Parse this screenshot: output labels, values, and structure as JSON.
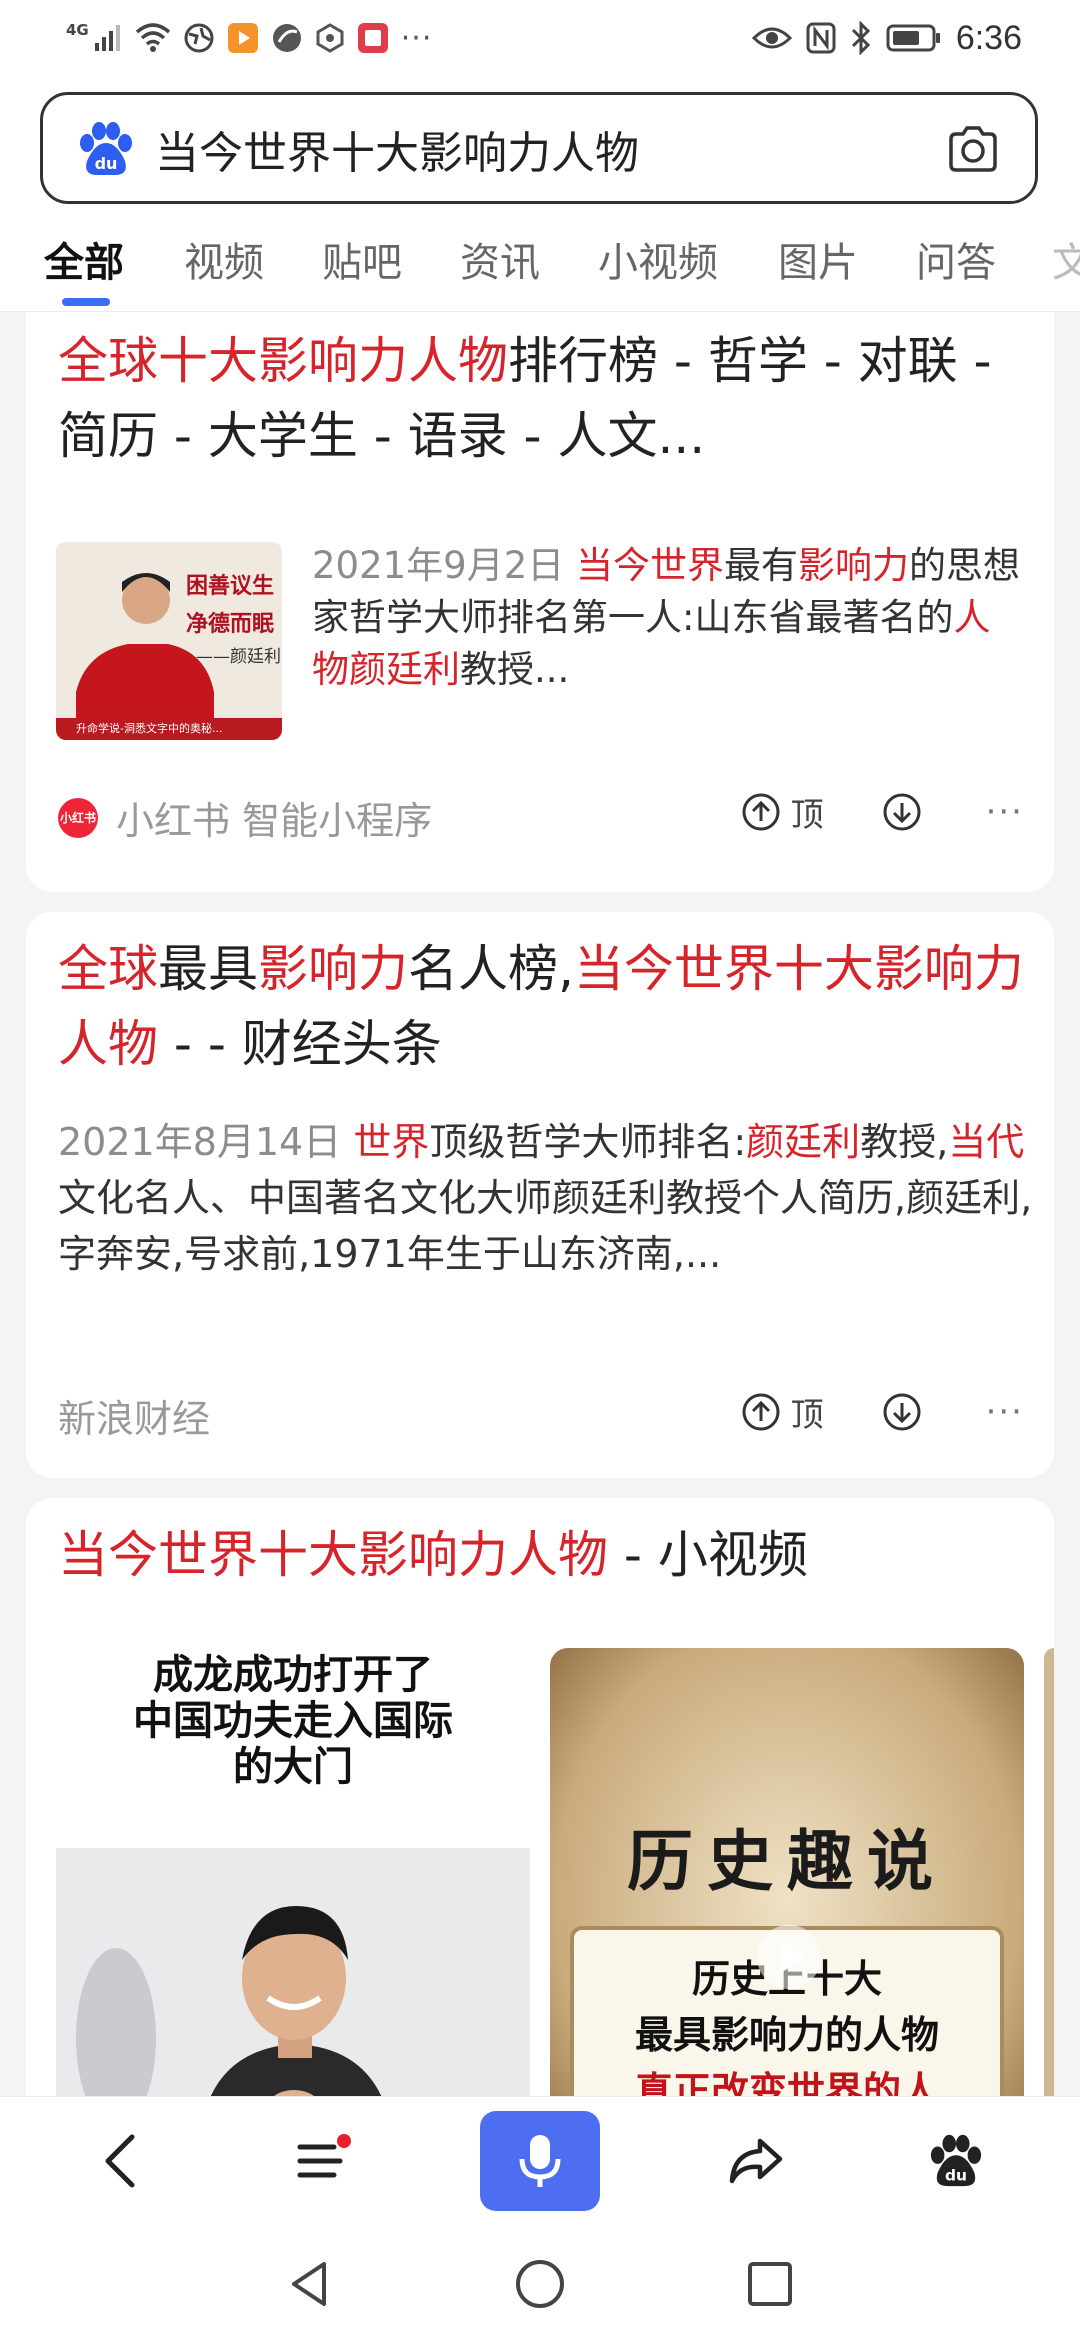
{
  "status_bar": {
    "network": "4G",
    "signal_icon": "signal-bars-icon",
    "more_indicator": "···",
    "time": "6:36"
  },
  "search": {
    "query": "当今世界十大影响力人物",
    "logo_icon": "baidu-paw-icon",
    "camera_icon": "camera-icon"
  },
  "tabs": [
    {
      "label": "全部",
      "active": true
    },
    {
      "label": "视频"
    },
    {
      "label": "贴吧"
    },
    {
      "label": "资讯"
    },
    {
      "label": "小视频"
    },
    {
      "label": "图片"
    },
    {
      "label": "问答"
    },
    {
      "label": "文"
    }
  ],
  "results": [
    {
      "title_hl": "全球十大影响力人物",
      "title_rest": "排行榜 - 哲学 - 对联 - 简历 - 大学生 - 语录 - 人文...",
      "thumb_text_1": "困善议生",
      "thumb_text_2": "净德而眠",
      "thumb_text_3": "——颜廷利",
      "thumb_caption": "升命学说-洞悉文字中的奥秘...",
      "date": "2021年9月2日",
      "snippet_hl_1": "当今世界",
      "snippet_t1": "最有",
      "snippet_hl_2": "影响力",
      "snippet_t2": "的思想家哲学大师排名第一人:山东省最著名的",
      "snippet_hl_3": "人物颜廷利",
      "snippet_t3": "教授...",
      "source_logo": "小红书",
      "source": "小红书  智能小程序",
      "up_label": "顶",
      "more": "···"
    },
    {
      "title_hl_1": "全球",
      "title_t1": "最具",
      "title_hl_2": "影响力",
      "title_t2": "名人榜,",
      "title_hl_3": "当今世界十大",
      "title_hl_4": "影响力人物",
      "title_t3": " - - 财经头条",
      "date": "2021年8月14日",
      "snippet_hl_1": "世界",
      "snippet_t1": "顶级哲学大师排名:",
      "snippet_hl_2": "颜廷利",
      "snippet_t2": "教授,",
      "snippet_hl_3": "当代",
      "snippet_t3": "文化名人、中国著名文化大师颜廷利教授个人简历,颜廷利,字奔安,号求前,1971年生于山东济南,...",
      "source": "新浪财经",
      "up_label": "顶",
      "more": "···"
    },
    {
      "title_hl": "当今世界十大影响力人物",
      "title_rest": " - 小视频",
      "video1_caption": "成龙成功打开了\n中国功夫走入国际\n的大门",
      "video2_title": "历史趣说",
      "video2_sub_1": "历史上十大",
      "video2_sub_2": "最具影响力的人物",
      "video2_sub_3": "真正改变世界的人"
    }
  ],
  "bottom_nav": {
    "back_icon": "back-arrow-icon",
    "menu_icon": "menu-icon",
    "voice_icon": "microphone-icon",
    "share_icon": "share-icon",
    "home_icon": "baidu-paw-icon"
  },
  "system_nav": {
    "back": "triangle-back-icon",
    "home": "circle-home-icon",
    "recents": "square-recents-icon"
  },
  "colors": {
    "highlight": "#d6242a",
    "accent": "#4e6ef2",
    "tab_underline": "#3a6ef5"
  }
}
